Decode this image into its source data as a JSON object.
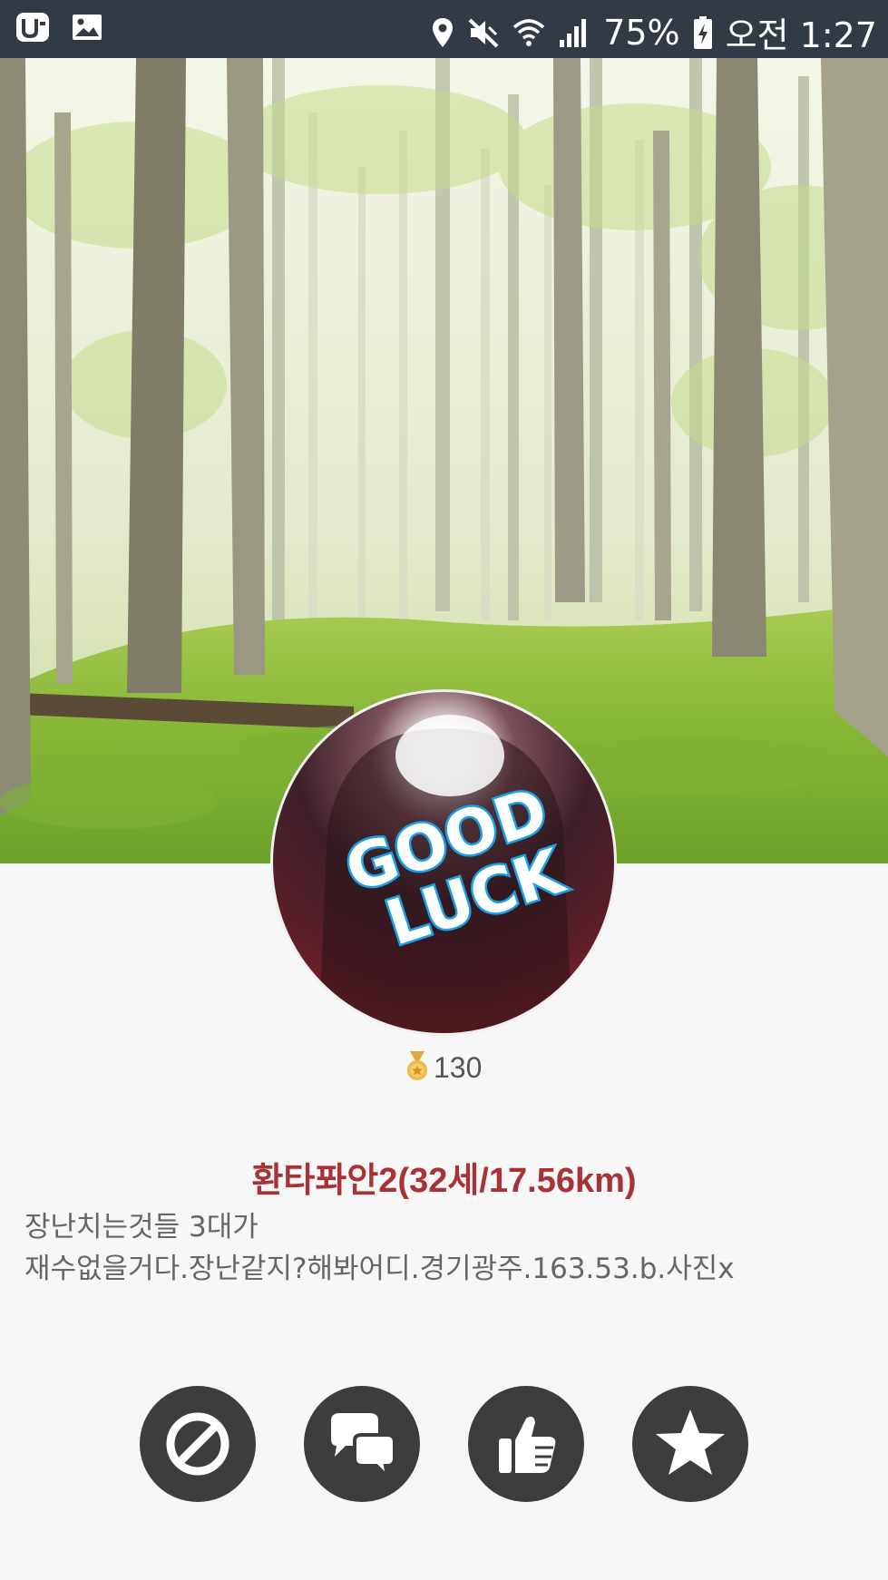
{
  "status_bar": {
    "battery_percent": "75%",
    "time": "오전 1:27",
    "icons": [
      "app-u-icon",
      "gallery-icon",
      "location-icon",
      "mute-icon",
      "wifi-icon",
      "signal-icon",
      "battery-charging-icon"
    ]
  },
  "profile": {
    "points": "130",
    "name_line": "환타퐈안2(32세/17.56km)",
    "status_line1": "장난치는것들 3대가",
    "status_line2": "재수없을거다.장난같지?해봐어디.경기광주.163.53.b.사진x",
    "avatar_sticker_text": "GOOD LUCK"
  },
  "actions": [
    {
      "name": "block",
      "icon": "block-icon"
    },
    {
      "name": "chat",
      "icon": "chat-bubbles-icon"
    },
    {
      "name": "like",
      "icon": "thumbs-up-icon"
    },
    {
      "name": "favorite",
      "icon": "star-icon"
    }
  ],
  "colors": {
    "status_bar_bg": "#323a46",
    "name_color": "#a83236",
    "action_button_bg": "#3d3d3d",
    "background": "#f7f7f7"
  }
}
